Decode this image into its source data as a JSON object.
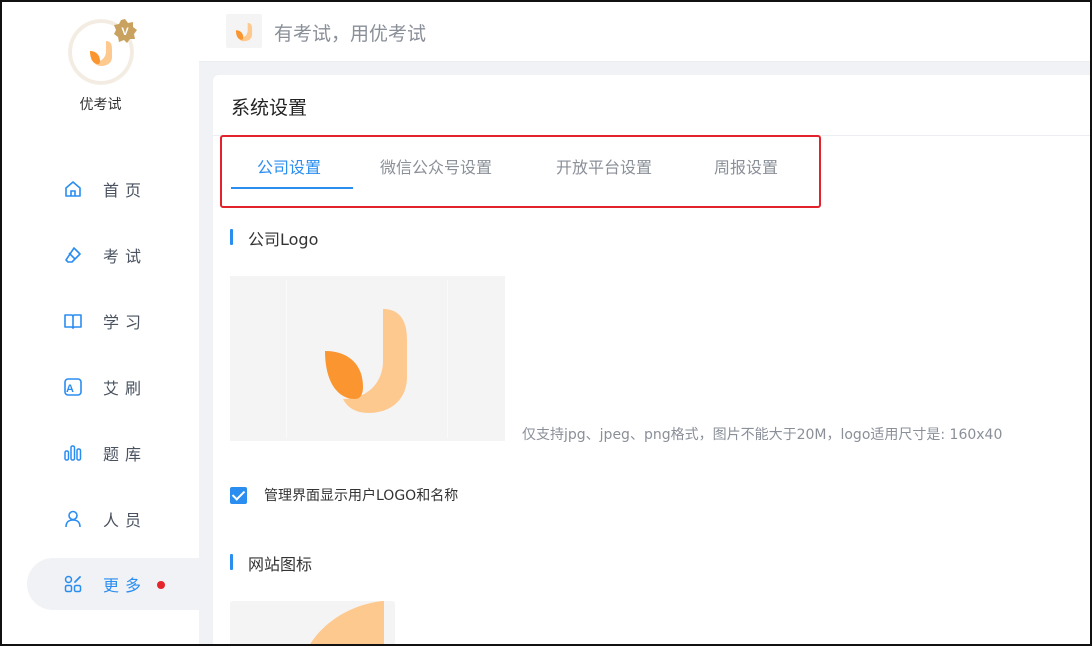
{
  "brand": {
    "name": "优考试",
    "slogan": "有考试，用优考试"
  },
  "nav": {
    "items": [
      {
        "label": "首页",
        "icon": "home-icon",
        "active": false
      },
      {
        "label": "考试",
        "icon": "eraser-icon",
        "active": false
      },
      {
        "label": "学习",
        "icon": "book-icon",
        "active": false
      },
      {
        "label": "艾刷",
        "icon": "letter-a-icon",
        "active": false
      },
      {
        "label": "题库",
        "icon": "bar-chart-icon",
        "active": false
      },
      {
        "label": "人员",
        "icon": "user-icon",
        "active": false
      },
      {
        "label": "更多",
        "icon": "apps-icon",
        "active": true
      }
    ]
  },
  "page": {
    "title": "系统设置",
    "tabs": [
      {
        "label": "公司设置",
        "active": true
      },
      {
        "label": "微信公众号设置",
        "active": false
      },
      {
        "label": "开放平台设置",
        "active": false
      },
      {
        "label": "周报设置",
        "active": false
      }
    ],
    "logo_section": {
      "heading": "公司Logo",
      "hint": "仅支持jpg、jpeg、png格式，图片不能大于20M，logo适用尺寸是: 160x40"
    },
    "show_logo_checkbox": {
      "label": "管理界面显示用户LOGO和名称",
      "checked": true
    },
    "favicon_section": {
      "heading": "网站图标"
    }
  },
  "colors": {
    "accent": "#2a8df0",
    "highlight_border": "#e3232b",
    "logo_orange_dark": "#fb9530",
    "logo_orange_light": "#fec98f",
    "notification_dot": "#e5242b"
  }
}
